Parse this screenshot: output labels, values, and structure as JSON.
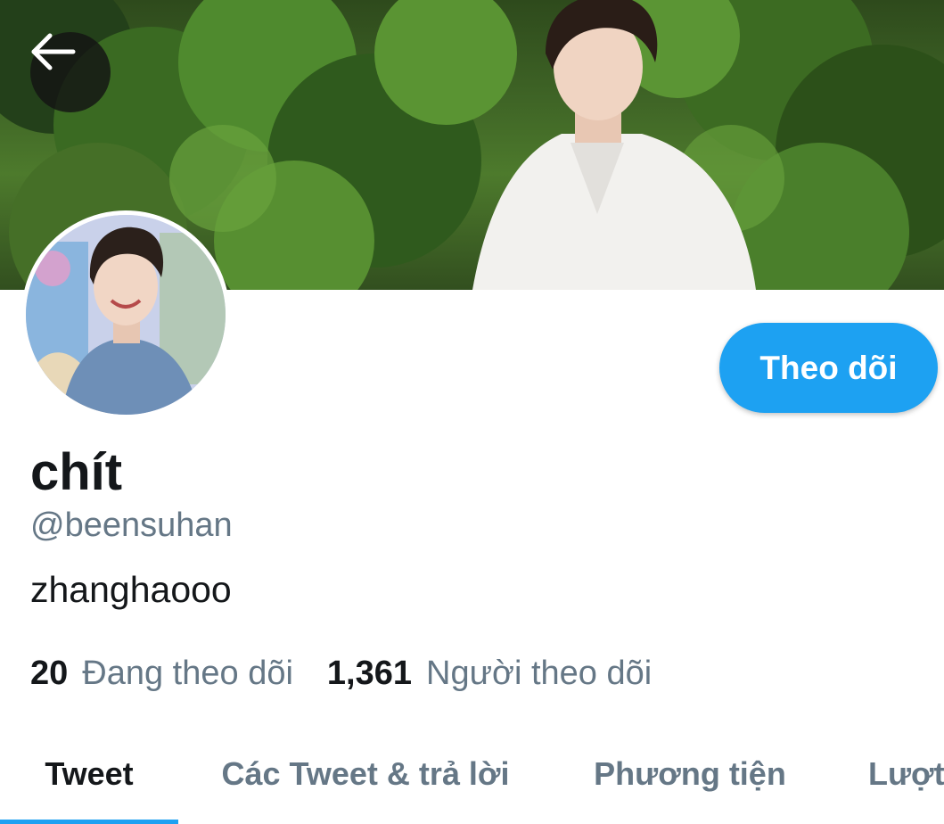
{
  "header": {
    "back_icon": "arrow-left-icon"
  },
  "profile": {
    "display_name": "chít",
    "handle": "@beensuhan",
    "bio": "zhanghaooo",
    "follow_label": "Theo dõi"
  },
  "stats": {
    "following_count": "20",
    "following_label": "Đang theo dõi",
    "followers_count": "1,361",
    "followers_label": "Người theo dõi"
  },
  "tabs": [
    {
      "label": "Tweet",
      "active": true
    },
    {
      "label": "Các Tweet & trả lời",
      "active": false
    },
    {
      "label": "Phương tiện",
      "active": false
    },
    {
      "label": "Lượt",
      "active": false
    }
  ],
  "colors": {
    "accent": "#1da1f2",
    "text_primary": "#14171a",
    "text_secondary": "#657786"
  }
}
